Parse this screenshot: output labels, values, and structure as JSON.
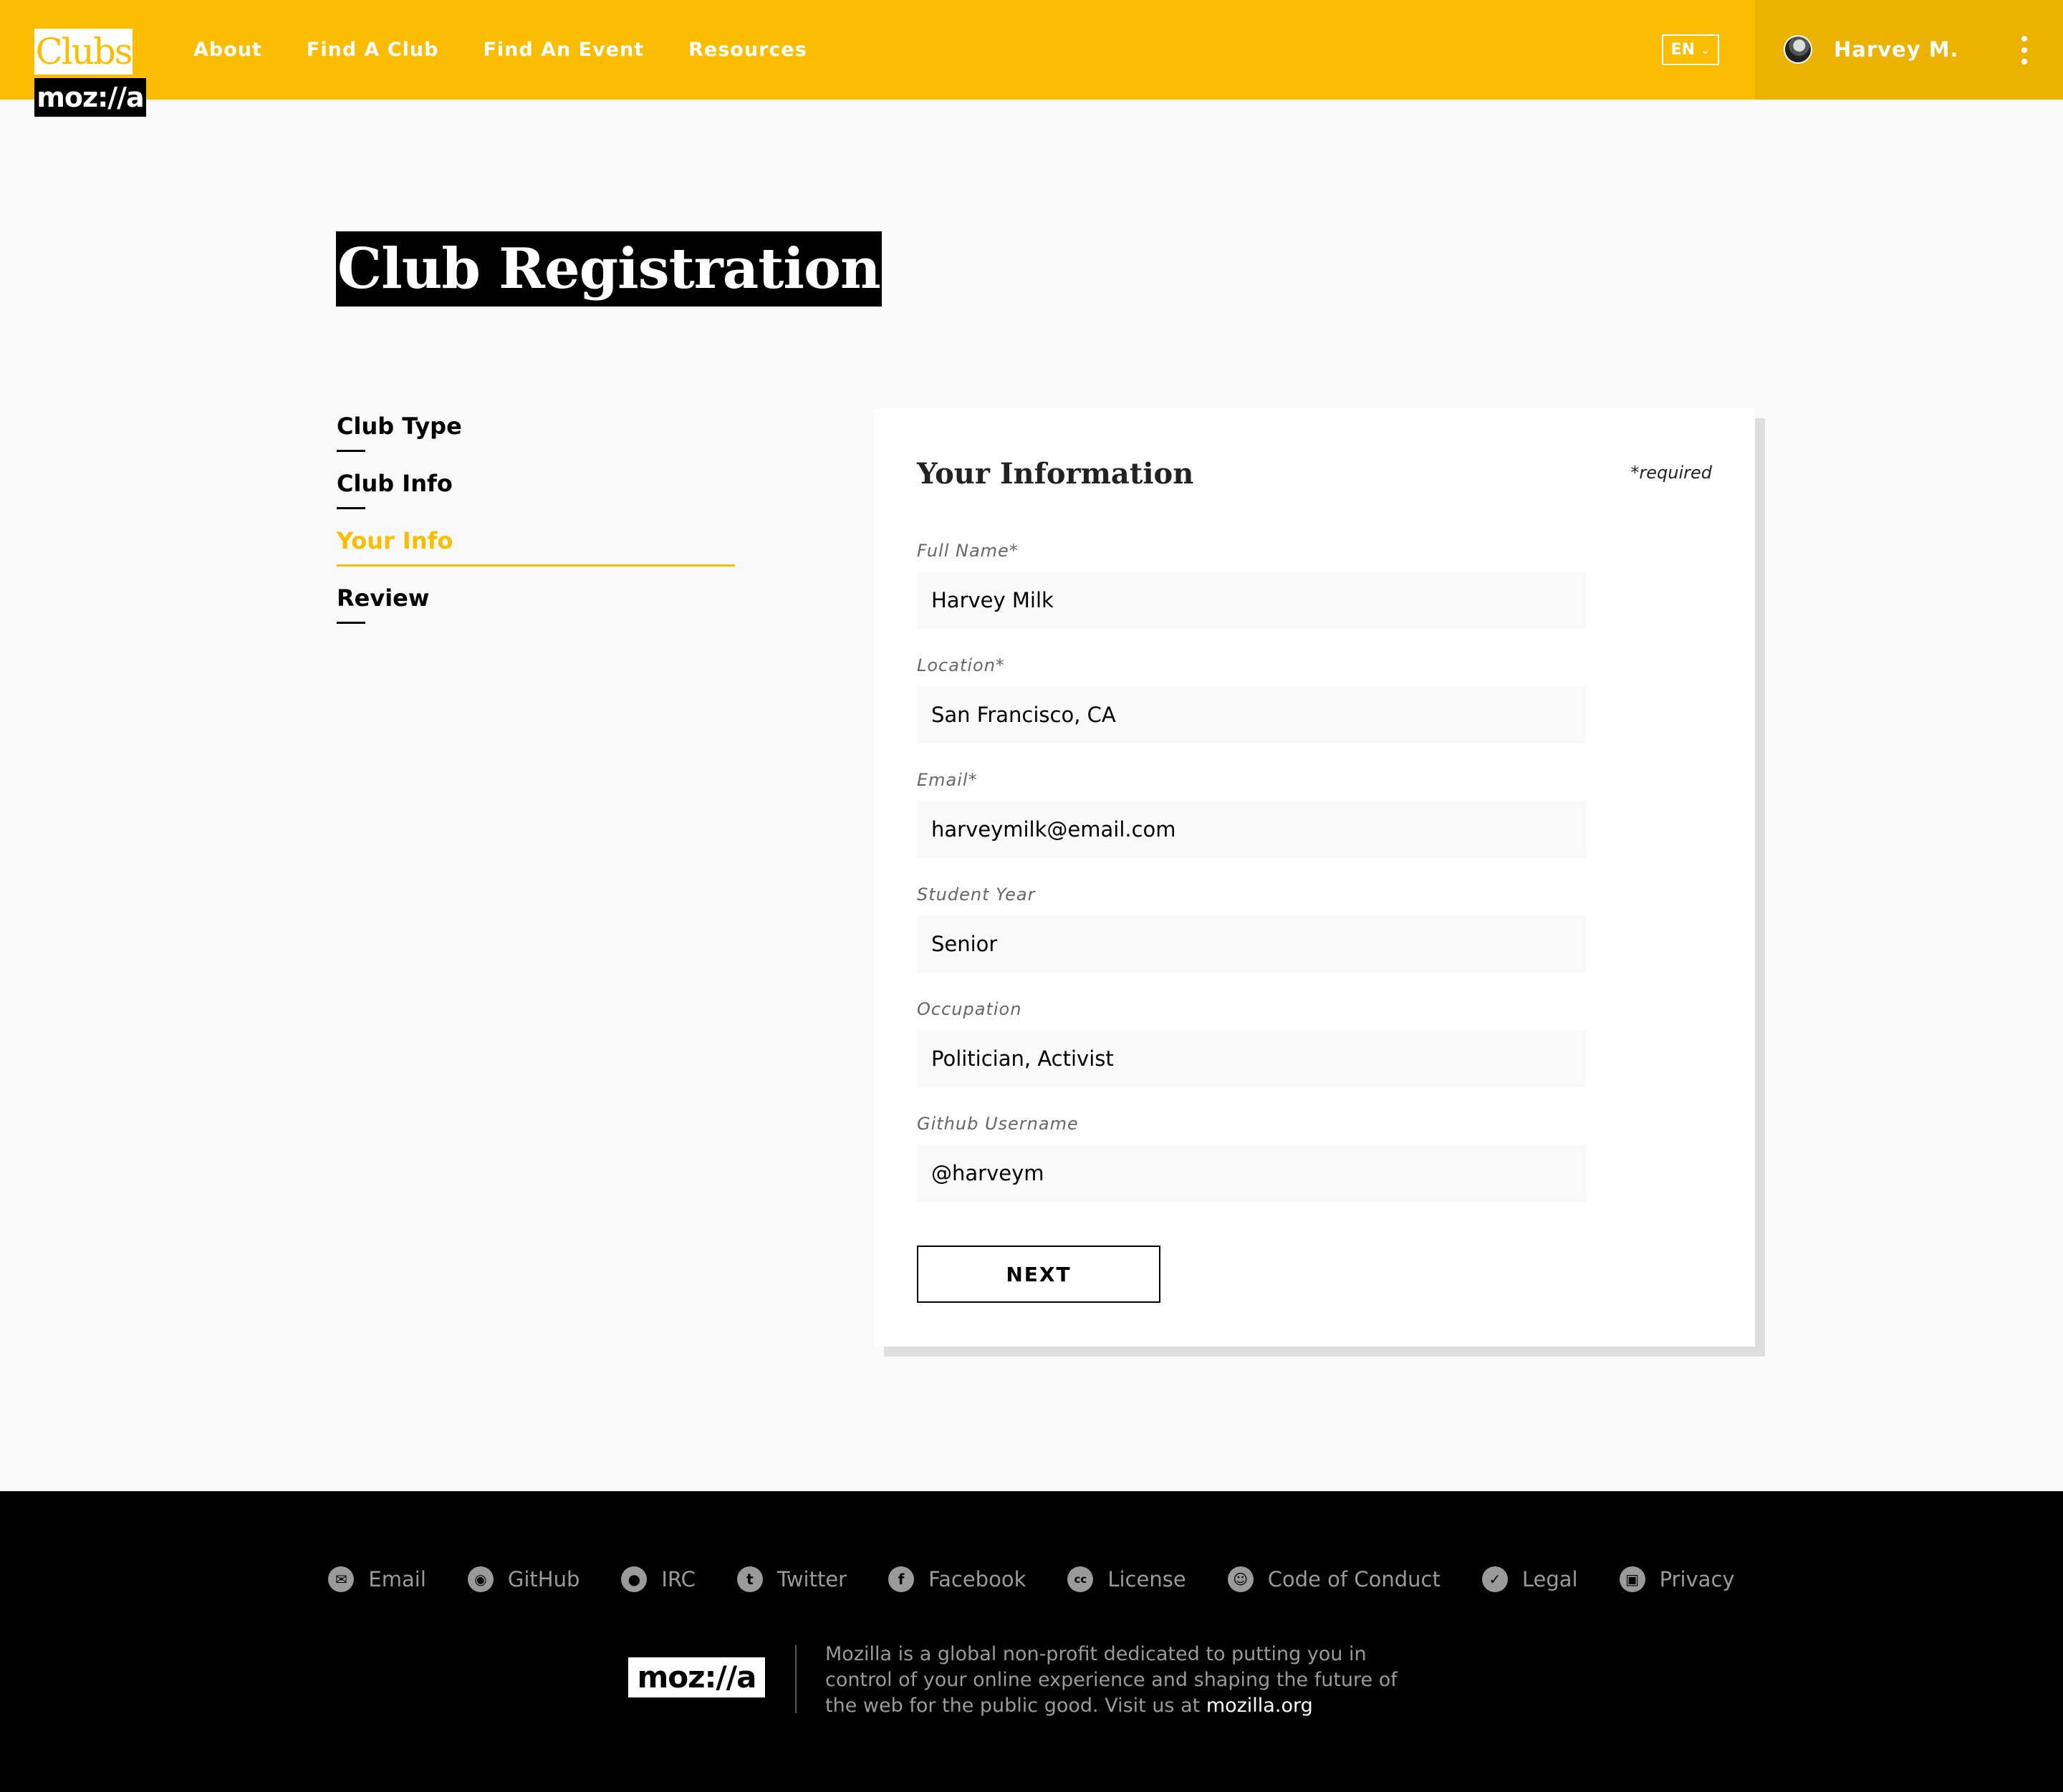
{
  "header": {
    "logo_top": "Clubs",
    "logo_bottom": "moz://a",
    "nav": [
      "About",
      "Find A Club",
      "Find An Event",
      "Resources"
    ],
    "language": "EN",
    "user_name": "Harvey M."
  },
  "page_title": "Club Registration",
  "steps": [
    {
      "label": "Club Type",
      "active": false
    },
    {
      "label": "Club Info",
      "active": false
    },
    {
      "label": "Your Info",
      "active": true
    },
    {
      "label": "Review",
      "active": false
    }
  ],
  "form": {
    "title": "Your Information",
    "required_note": "*required",
    "fields": [
      {
        "label": "Full Name*",
        "value": "Harvey Milk"
      },
      {
        "label": "Location*",
        "value": "San Francisco, CA"
      },
      {
        "label": "Email*",
        "value": "harveymilk@email.com"
      },
      {
        "label": "Student Year",
        "value": "Senior"
      },
      {
        "label": "Occupation",
        "value": "Politician, Activist"
      },
      {
        "label": "Github Username",
        "value": "@harveym"
      }
    ],
    "next_label": "NEXT"
  },
  "footer": {
    "links": [
      {
        "label": "Email",
        "icon": "email-icon"
      },
      {
        "label": "GitHub",
        "icon": "github-icon"
      },
      {
        "label": "IRC",
        "icon": "chat-icon"
      },
      {
        "label": "Twitter",
        "icon": "twitter-icon"
      },
      {
        "label": "Facebook",
        "icon": "facebook-icon"
      },
      {
        "label": "License",
        "icon": "creative-commons-icon"
      },
      {
        "label": "Code of Conduct",
        "icon": "smiley-icon"
      },
      {
        "label": "Legal",
        "icon": "checkmark-icon"
      },
      {
        "label": "Privacy",
        "icon": "lock-icon"
      }
    ],
    "logo": "moz://a",
    "about_text": "Mozilla is a global non-profit dedicated to putting you in control of your online experience and shaping the future of the web for the public good. Visit us at",
    "about_link": "mozilla.org"
  },
  "colors": {
    "accent": "#fbbd02",
    "user_area": "#ebb300",
    "footer_bg": "#000000"
  }
}
